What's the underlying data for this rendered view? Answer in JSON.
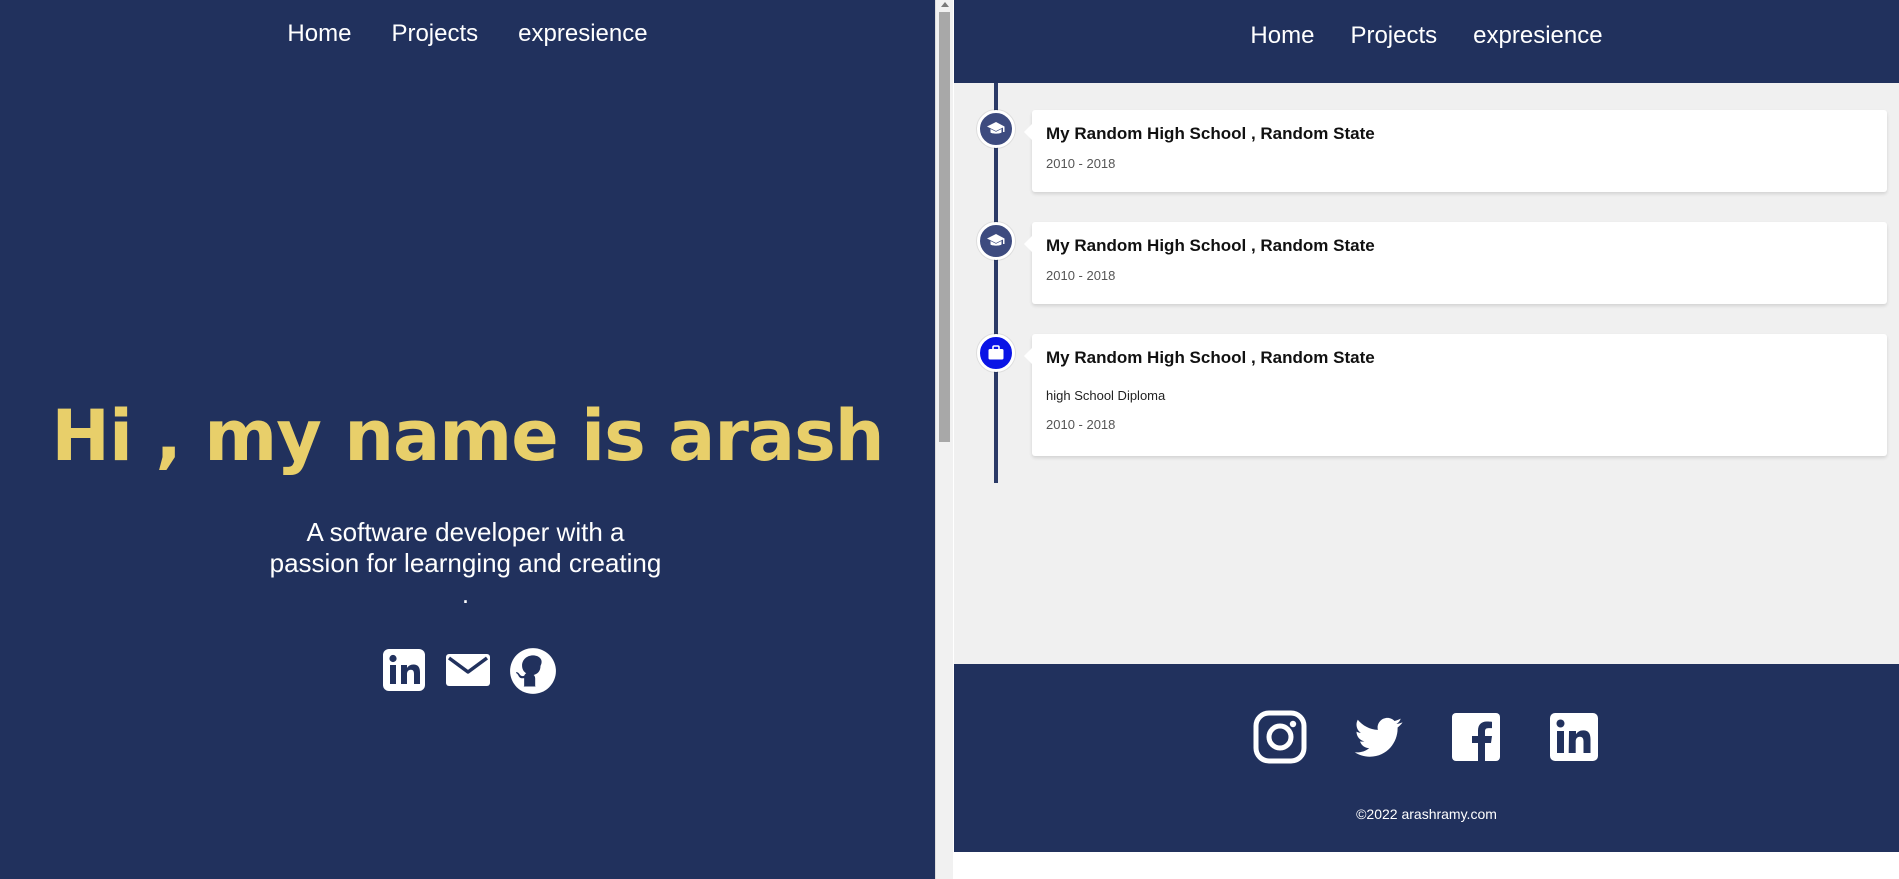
{
  "left": {
    "nav": [
      "Home",
      "Projects",
      "expresience"
    ],
    "hero_title": "Hi , my name is arash",
    "hero_subtitle": "A software developer with a passion for learnging and creating .",
    "social_icons": [
      "linkedin-icon",
      "email-icon",
      "github-icon"
    ]
  },
  "right": {
    "nav": [
      "Home",
      "Projects",
      "expresience"
    ],
    "timeline": [
      {
        "icon": "graduation-cap-icon",
        "icon_color": "#3d4b7f",
        "title": "My Random High School , Random State",
        "description": "",
        "date": "2010 - 2018"
      },
      {
        "icon": "graduation-cap-icon",
        "icon_color": "#3d4b7f",
        "title": "My Random High School , Random State",
        "description": "",
        "date": "2010 - 2018"
      },
      {
        "icon": "briefcase-icon",
        "icon_color": "#0a14e6",
        "title": "My Random High School , Random State",
        "description": "high School Diploma",
        "date": "2010 - 2018"
      }
    ],
    "footer": {
      "social_icons": [
        "instagram-icon",
        "twitter-icon",
        "facebook-icon",
        "linkedin-icon"
      ],
      "copyright": "©2022 arashramy.com"
    }
  },
  "colors": {
    "navy": "#21315d",
    "accent_yellow": "#e8cf6a",
    "content_bg": "#f0f0f0",
    "work_icon_blue": "#0a14e6"
  }
}
